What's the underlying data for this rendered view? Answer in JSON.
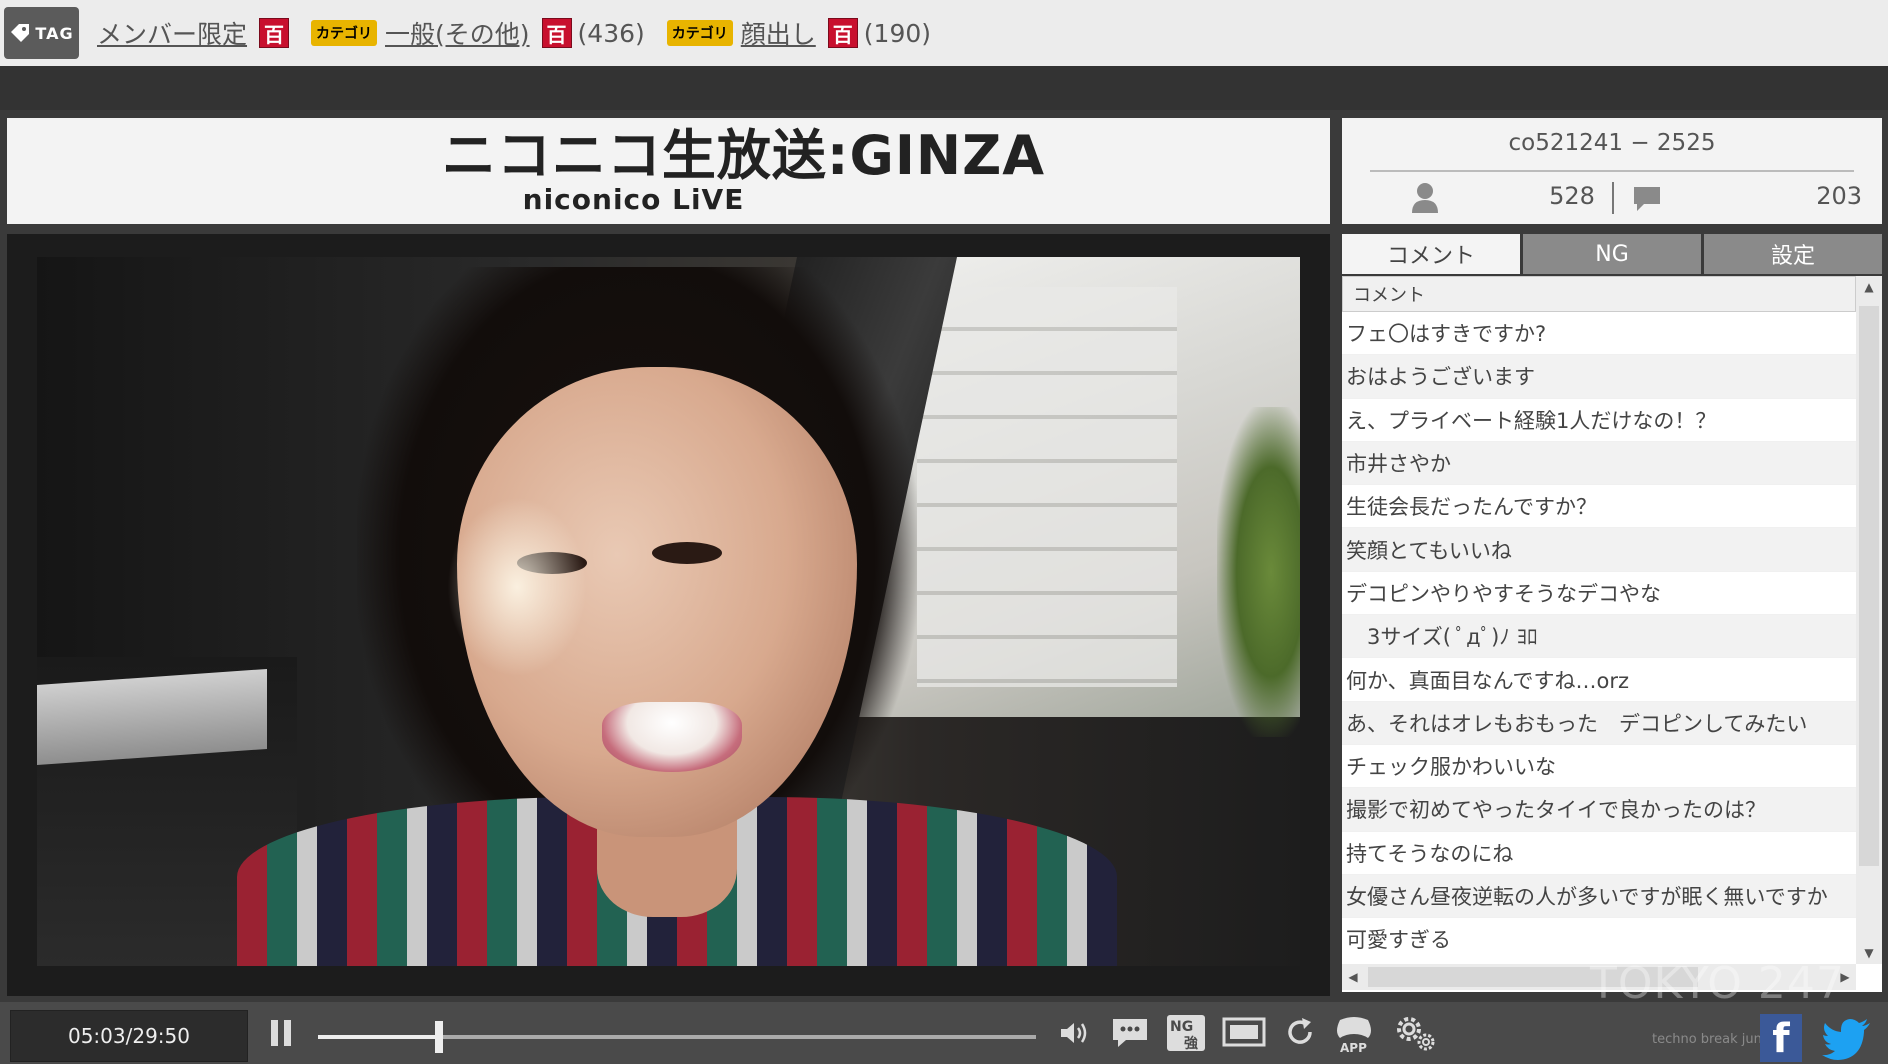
{
  "tagbar": {
    "badge": "TAG",
    "tags": [
      {
        "label": "メンバー限定",
        "dic": "百"
      },
      {
        "category": "カテゴリ",
        "label": "一般(その他)",
        "dic": "百",
        "count": "(436)"
      },
      {
        "category": "カテゴリ",
        "label": "顔出し",
        "dic": "百",
        "count": "(190)"
      }
    ]
  },
  "header": {
    "logo_main": "ニコニコ生放送:GINZA",
    "logo_sub": "niconico LiVE"
  },
  "info": {
    "live_id": "co521241 − 2525",
    "viewers": "528",
    "comments": "203"
  },
  "tabs": [
    {
      "label": "コメント",
      "active": true
    },
    {
      "label": "NG",
      "active": false
    },
    {
      "label": "設定",
      "active": false
    }
  ],
  "comment_header": "コメント",
  "comments": [
    "フェ〇はすきですか?",
    "おはようございます",
    "え、プライベート経験1人だけなの！？",
    "市井さやか",
    "生徒会長だったんですか？",
    "笑顔とてもいいね",
    "デコピンやりやすそうなデコやな",
    "　3サイズ( ﾟдﾟ)ﾉ ﾖﾛ",
    "何か、真面目なんですね…orz",
    "あ、それはオレもおもった　デコピンしてみたい",
    "チェック服かわいいな",
    "撮影で初めてやったタイイで良かったのは？",
    "持てそうなのにね",
    "女優さん昼夜逆転の人が多いですが眠く無いですか",
    "可愛すぎる"
  ],
  "player": {
    "time": "05:03/29:50",
    "progress": 0.169
  },
  "watermark": {
    "main": "TOKYO 247",
    "sub": "techno break junction"
  },
  "colors": {
    "dic_red": "#c8102e",
    "category_yellow": "#e8b400",
    "facebook_blue": "#3b5998",
    "twitter_blue": "#1da1f2"
  }
}
